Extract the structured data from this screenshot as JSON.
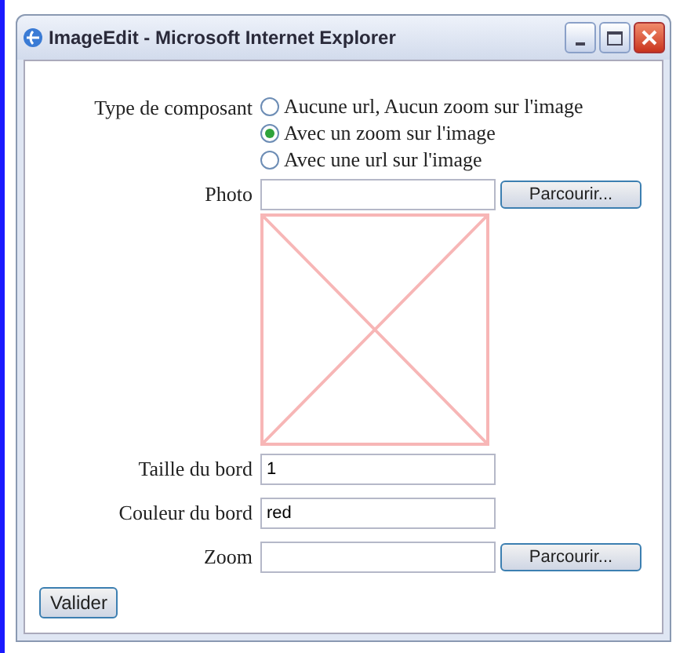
{
  "window": {
    "title": "ImageEdit - Microsoft Internet Explorer"
  },
  "component_type": {
    "label": "Type de composant",
    "options": [
      {
        "label": "Aucune url, Aucun zoom sur l'image",
        "selected": false
      },
      {
        "label": "Avec un zoom sur l'image",
        "selected": true
      },
      {
        "label": "Avec une url sur l'image",
        "selected": false
      }
    ]
  },
  "photo": {
    "label": "Photo",
    "browse_button": "Parcourir..."
  },
  "border_size": {
    "label": "Taille du bord",
    "value": "1"
  },
  "border_color": {
    "label": "Couleur du bord",
    "value": "red"
  },
  "zoom": {
    "label": "Zoom",
    "browse_button": "Parcourir..."
  },
  "submit_button": "Valider"
}
